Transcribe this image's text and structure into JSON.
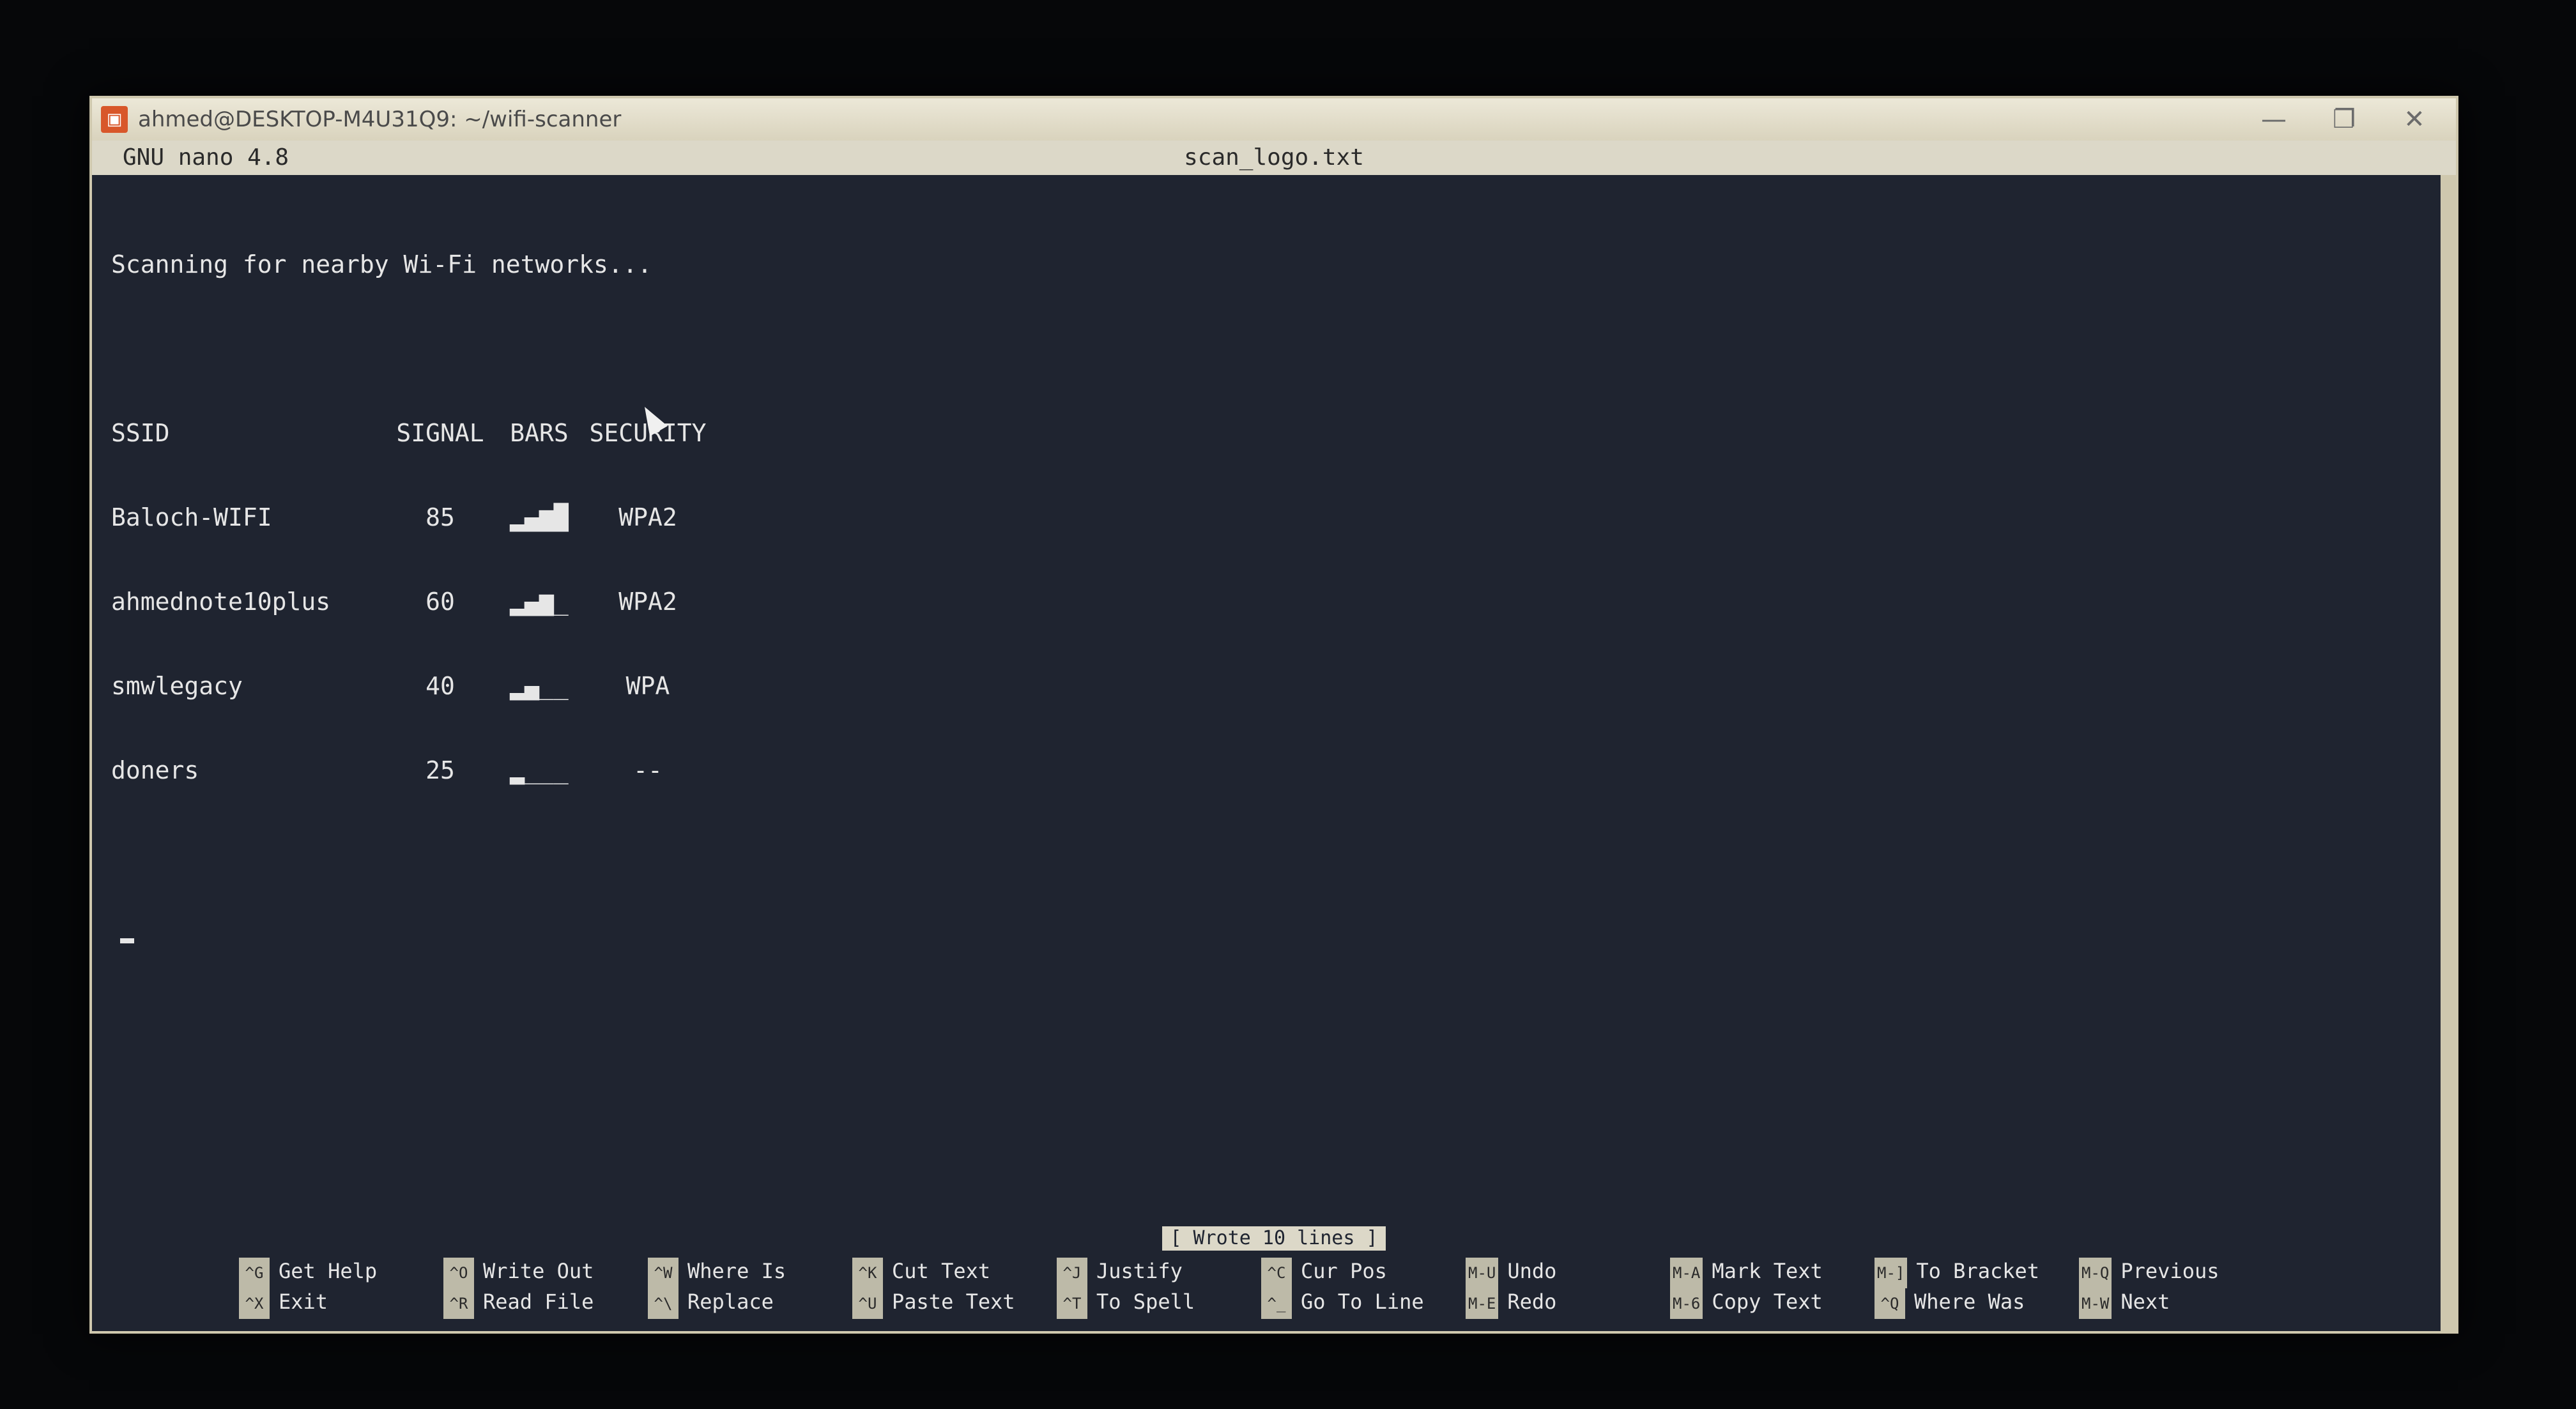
{
  "window": {
    "title": "ahmed@DESKTOP-M4U31Q9: ~/wifi-scanner"
  },
  "nano": {
    "version": "GNU nano 4.8",
    "filename": "scan_logo.txt",
    "status": "[ Wrote 10 lines ]"
  },
  "content": {
    "scanning": "Scanning for nearby Wi-Fi networks...",
    "headers": {
      "ssid": "SSID",
      "signal": "SIGNAL",
      "bars": "BARS",
      "security": "SECURITY"
    },
    "rows": [
      {
        "ssid": "Baloch-WIFI",
        "signal": "85",
        "bars": "▂▄▆█",
        "security": "WPA2"
      },
      {
        "ssid": "ahmednote10plus",
        "signal": "60",
        "bars": "▂▄▆_",
        "security": "WPA2"
      },
      {
        "ssid": "smwlegacy",
        "signal": "40",
        "bars": "▂▄__",
        "security": "WPA"
      },
      {
        "ssid": "doners",
        "signal": "25",
        "bars": "▂___",
        "security": "--"
      }
    ]
  },
  "shortcuts": [
    {
      "top": {
        "key": "^G",
        "label": "Get Help"
      },
      "bottom": {
        "key": "^X",
        "label": "Exit"
      }
    },
    {
      "top": {
        "key": "^O",
        "label": "Write Out"
      },
      "bottom": {
        "key": "^R",
        "label": "Read File"
      }
    },
    {
      "top": {
        "key": "^W",
        "label": "Where Is"
      },
      "bottom": {
        "key": "^\\",
        "label": "Replace"
      }
    },
    {
      "top": {
        "key": "^K",
        "label": "Cut Text"
      },
      "bottom": {
        "key": "^U",
        "label": "Paste Text"
      }
    },
    {
      "top": {
        "key": "^J",
        "label": "Justify"
      },
      "bottom": {
        "key": "^T",
        "label": "To Spell"
      }
    },
    {
      "top": {
        "key": "^C",
        "label": "Cur Pos"
      },
      "bottom": {
        "key": "^_",
        "label": "Go To Line"
      }
    },
    {
      "top": {
        "key": "M-U",
        "label": "Undo"
      },
      "bottom": {
        "key": "M-E",
        "label": "Redo"
      }
    },
    {
      "top": {
        "key": "M-A",
        "label": "Mark Text"
      },
      "bottom": {
        "key": "M-6",
        "label": "Copy Text"
      }
    },
    {
      "top": {
        "key": "M-]",
        "label": "To Bracket"
      },
      "bottom": {
        "key": "^Q",
        "label": "Where Was"
      }
    },
    {
      "top": {
        "key": "M-Q",
        "label": "Previous"
      },
      "bottom": {
        "key": "M-W",
        "label": "Next"
      }
    }
  ],
  "icons": {
    "app": "terminal-app-icon",
    "minimize": "minimize-icon",
    "maximize": "maximize-icon",
    "close": "close-icon"
  },
  "colors": {
    "terminal_bg": "#1f2430",
    "text": "#e6e6e6",
    "header_bar": "#dcd8c8",
    "frame": "#cfc8ae"
  }
}
